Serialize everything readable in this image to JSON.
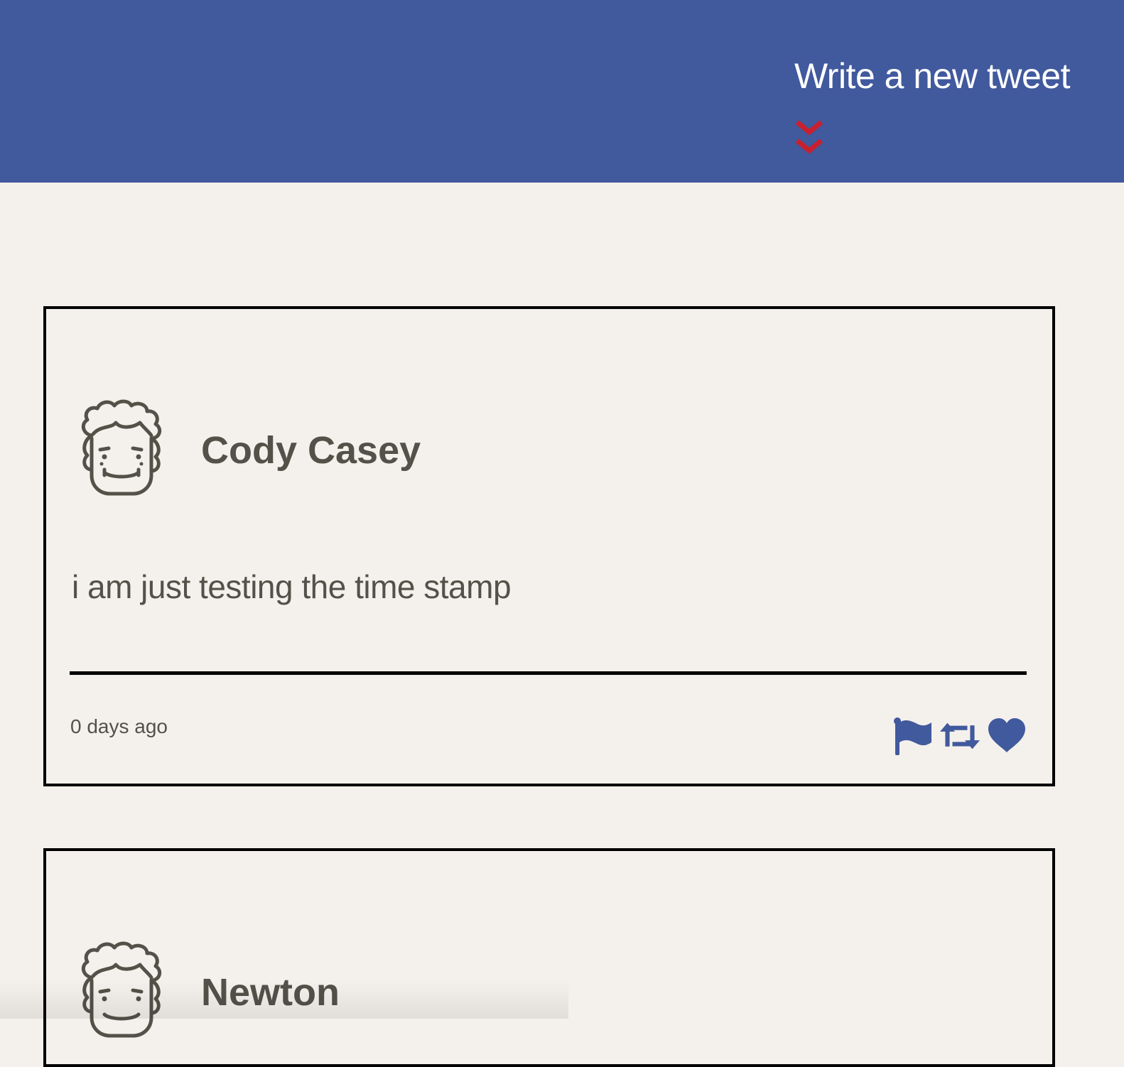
{
  "header": {
    "compose_label": "Write a new tweet",
    "compose_icon": "double-chevron-down-icon",
    "background_color": "#41599d",
    "icon_color": "#c8202e"
  },
  "tweets": [
    {
      "user": {
        "name": "Cody Casey",
        "avatar_icon": "curly-hair-face-avatar"
      },
      "content": "i am just testing the time stamp",
      "timestamp": "0 days ago",
      "actions": [
        "flag-icon",
        "retweet-icon",
        "heart-icon"
      ]
    },
    {
      "user": {
        "name": "Newton",
        "avatar_icon": "curly-hair-face-avatar"
      },
      "content": "",
      "timestamp": "",
      "actions": []
    }
  ],
  "colors": {
    "page_background": "#f4f1ec",
    "text": "#545149",
    "action_icons": "#41599d"
  }
}
